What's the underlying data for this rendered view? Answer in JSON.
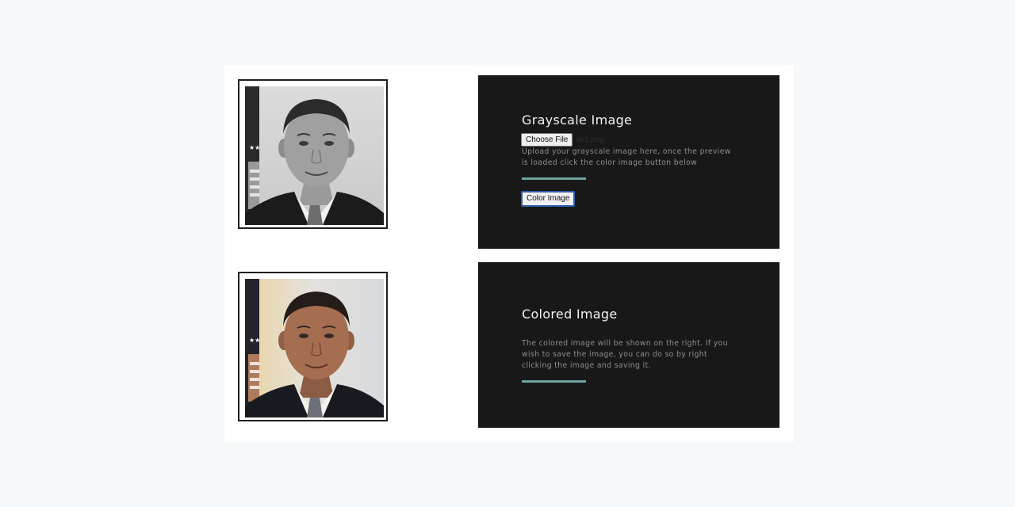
{
  "grayscale_section": {
    "title": "Grayscale Image",
    "file_button": "Choose File",
    "file_name": "ok1.png",
    "description": "Upload your grayscale image here, once the preview is loaded click the color image button below",
    "color_button": "Color Image"
  },
  "colored_section": {
    "title": "Colored Image",
    "description": "The colored image will be shown on the right. If you wish to save the image, you can do so by right clicking the image and saving it."
  },
  "colors": {
    "panel_background": "#181818",
    "accent_underline": "#6aa39f",
    "button_focus_border": "#2d5fb0"
  }
}
